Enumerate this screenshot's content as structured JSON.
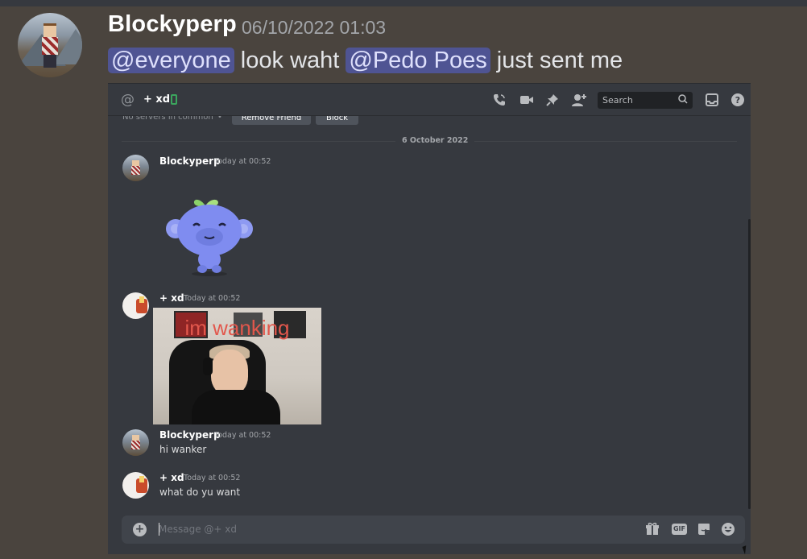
{
  "outer_message": {
    "username": "Blockyperp",
    "timestamp": "06/10/2022 01:03",
    "mention_everyone": "@everyone",
    "text_1": " look waht ",
    "mention_user": "@Pedo Poes",
    "text_2": " just sent me"
  },
  "screenshot": {
    "header": {
      "at_symbol": "@",
      "channel_name": "+ xd",
      "search_placeholder": "Search",
      "icons": [
        "phone-call-icon",
        "video-camera-icon",
        "pin-icon",
        "add-friend-icon",
        "inbox-icon",
        "help-icon"
      ]
    },
    "profile_strip": {
      "servers_text": "No servers in common",
      "remove_friend": "Remove Friend",
      "block": "Block"
    },
    "date_divider": "6 October 2022",
    "messages": [
      {
        "author": "Blockyperp",
        "timestamp": "Today at 00:52",
        "content": "",
        "attachment": "wumpus-sticker"
      },
      {
        "author": "+ xd",
        "timestamp": "Today at 00:52",
        "content": "",
        "attachment_text": "im wanking"
      },
      {
        "author": "Blockyperp",
        "timestamp": "Today at 00:52",
        "content": "hi wanker"
      },
      {
        "author": "+ xd",
        "timestamp": "Today at 00:52",
        "content": "what do yu want"
      }
    ],
    "composer": {
      "placeholder": "Message @+ xd",
      "gif_label": "GIF",
      "icons": [
        "attach-plus-icon",
        "gift-icon",
        "gif-icon",
        "sticker-icon",
        "emoji-icon"
      ]
    }
  },
  "colors": {
    "background": "#4a443e",
    "screenshot_bg": "#36393f",
    "mention_bg": "#4f5493",
    "mention_text": "#dee0fc",
    "gif_caption": "#e2574c"
  }
}
